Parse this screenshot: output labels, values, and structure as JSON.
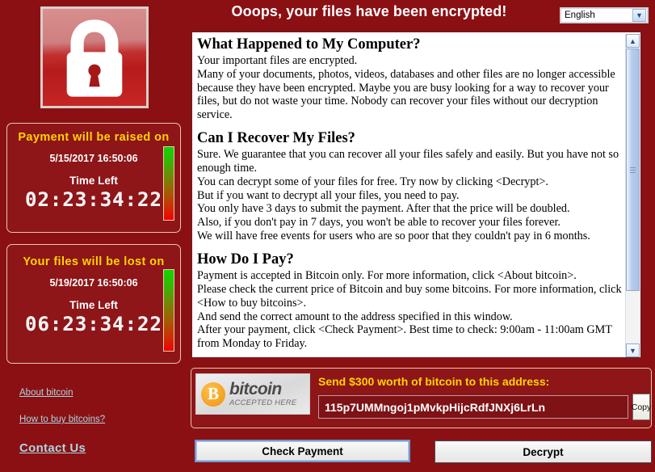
{
  "header": {
    "title": "Ooops, your files have been encrypted!",
    "language": {
      "value": "English",
      "arrow_icon": "chevron-down-icon"
    }
  },
  "sidebar": {
    "lock_icon": "padlock-icon",
    "panels": [
      {
        "id": "payment-raised",
        "title": "Payment will be raised on",
        "date": "5/15/2017 16:50:06",
        "subtitle": "Time Left",
        "countdown": "02:23:34:22",
        "gauge_top_color": "#12d400",
        "gauge_bottom_color": "#f10000"
      },
      {
        "id": "files-lost",
        "title": "Your files will be lost on",
        "date": "5/19/2017 16:50:06",
        "subtitle": "Time Left",
        "countdown": "06:23:34:22",
        "gauge_top_color": "#12d400",
        "gauge_bottom_color": "#f10000"
      }
    ],
    "links": [
      {
        "label": "About bitcoin",
        "emphasis": false
      },
      {
        "label": "How to buy bitcoins?",
        "emphasis": false
      },
      {
        "label": "Contact Us",
        "emphasis": true
      }
    ]
  },
  "main_text": {
    "sections": [
      {
        "heading": "What Happened to My Computer?",
        "lines": [
          "Your important files are encrypted.",
          "Many of your documents, photos, videos, databases and other files are no longer accessible",
          "because they have been encrypted. Maybe you are busy looking for a way to recover your",
          "files, but do not waste your time. Nobody can recover your files without our decryption",
          "service."
        ]
      },
      {
        "heading": "Can I Recover My Files?",
        "lines": [
          "Sure. We guarantee that you can recover all your files safely and easily. But you have not so",
          "enough time.",
          "You can decrypt some of your files for free. Try now by clicking <Decrypt>.",
          "But if you want to decrypt all your files, you need to pay.",
          "You only have 3 days to submit the payment. After that the price will be doubled.",
          "Also, if you don't pay in 7 days, you won't be able to recover your files forever.",
          "We will have free events for users who are so poor that they couldn't pay in 6 months."
        ]
      },
      {
        "heading": "How Do I Pay?",
        "lines": [
          "Payment is accepted in Bitcoin only. For more information, click <About bitcoin>.",
          "Please check the current price of Bitcoin and buy some bitcoins. For more information, click",
          "<How to buy bitcoins>.",
          "And send the correct amount to the address specified in this window.",
          "After your payment, click <Check Payment>. Best time to check: 9:00am - 11:00am GMT",
          "from Monday to Friday."
        ]
      }
    ],
    "scrollbar": {
      "up_arrow_icon": "chevron-up-icon",
      "down_arrow_icon": "chevron-down-icon",
      "grip_icon": "grip-lines-icon"
    }
  },
  "payment": {
    "logo": {
      "coin_glyph": "B",
      "wordmark": "bitcoin",
      "tagline": "ACCEPTED HERE",
      "coin_color": "#f0920e"
    },
    "instruction": "Send $300 worth of bitcoin to this address:",
    "address": "115p7UMMngoj1pMvkpHijcRdfJNXj6LrLn",
    "copy_label": "Copy"
  },
  "actions": {
    "check_payment": "Check Payment",
    "decrypt": "Decrypt"
  },
  "colors": {
    "page_background": "#8b1013",
    "panel_background": "#8e1518",
    "accent_yellow": "#ffd400",
    "link_blue": "#a9d6e0"
  }
}
